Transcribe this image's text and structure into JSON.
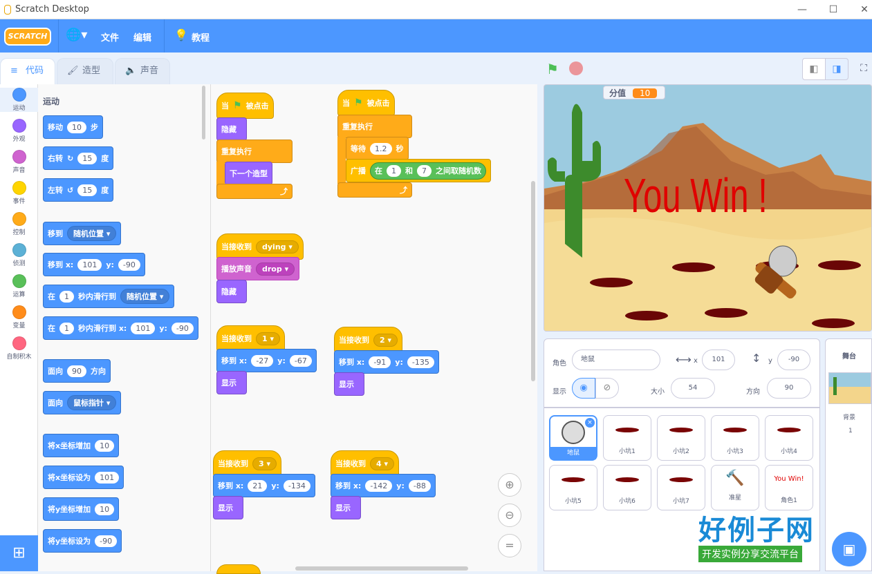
{
  "window": {
    "title": "Scratch Desktop"
  },
  "menu": {
    "logo": "SCRATCH",
    "file": "文件",
    "edit": "编辑",
    "tutorials": "教程"
  },
  "tabs": {
    "code": "代码",
    "costumes": "造型",
    "sounds": "声音"
  },
  "categories": [
    {
      "label": "运动",
      "color": "#4c97ff"
    },
    {
      "label": "外观",
      "color": "#9966ff"
    },
    {
      "label": "声音",
      "color": "#cf63cf"
    },
    {
      "label": "事件",
      "color": "#ffd500"
    },
    {
      "label": "控制",
      "color": "#ffab19"
    },
    {
      "label": "侦测",
      "color": "#5cb1d6"
    },
    {
      "label": "运算",
      "color": "#59c059"
    },
    {
      "label": "变量",
      "color": "#ff8c1a"
    },
    {
      "label": "自制积木",
      "color": "#ff6680"
    }
  ],
  "palette": {
    "section": "运动",
    "move": {
      "a": "移动",
      "n": "10",
      "b": "步"
    },
    "turn_right": {
      "a": "右转",
      "icon": "↻",
      "n": "15",
      "b": "度"
    },
    "turn_left": {
      "a": "左转",
      "icon": "↺",
      "n": "15",
      "b": "度"
    },
    "goto": {
      "a": "移到",
      "dd": "随机位置"
    },
    "goto_xy": {
      "a": "移到 x:",
      "x": "101",
      "b": "y:",
      "y": "-90"
    },
    "glide": {
      "a": "在",
      "n": "1",
      "b": "秒内滑行到",
      "dd": "随机位置"
    },
    "glide_xy": {
      "a": "在",
      "n": "1",
      "b": "秒内滑行到 x:",
      "x": "101",
      "c": "y:",
      "y": "-90"
    },
    "point": {
      "a": "面向",
      "n": "90",
      "b": "方向"
    },
    "point_towards": {
      "a": "面向",
      "dd": "鼠标指针"
    },
    "change_x": {
      "a": "将x坐标增加",
      "n": "10"
    },
    "set_x": {
      "a": "将x坐标设为",
      "n": "101"
    },
    "change_y": {
      "a": "将y坐标增加",
      "n": "10"
    },
    "set_y": {
      "a": "将y坐标设为",
      "n": "-90"
    }
  },
  "scripts": {
    "s1": {
      "hat_a": "当",
      "hat_b": "被点击",
      "hide": "隐藏",
      "forever": "重复执行",
      "next": "下一个造型"
    },
    "s2": {
      "hat_a": "当",
      "hat_b": "被点击",
      "forever": "重复执行",
      "wait_a": "等待",
      "wait_n": "1.2",
      "wait_b": "秒",
      "bc": "广播",
      "rand_a": "在",
      "rand_n1": "1",
      "rand_b": "和",
      "rand_n2": "7",
      "rand_c": "之间取随机数"
    },
    "s3": {
      "hat": "当接收到",
      "msg": "dying",
      "play": "播放声音",
      "snd": "drop",
      "hide": "隐藏"
    },
    "s4": {
      "hat": "当接收到",
      "msg": "1",
      "goto": "移到 x:",
      "x": "-27",
      "yl": "y:",
      "y": "-67",
      "show": "显示"
    },
    "s5": {
      "hat": "当接收到",
      "msg": "2",
      "goto": "移到 x:",
      "x": "-91",
      "yl": "y:",
      "y": "-135",
      "show": "显示"
    },
    "s6": {
      "hat": "当接收到",
      "msg": "3",
      "goto": "移到 x:",
      "x": "21",
      "yl": "y:",
      "y": "-134",
      "show": "显示"
    },
    "s7": {
      "hat": "当接收到",
      "msg": "4",
      "goto": "移到 x:",
      "x": "-142",
      "yl": "y:",
      "y": "-88",
      "show": "显示"
    }
  },
  "stage": {
    "monitor_label": "分值",
    "monitor_value": "10",
    "win_text": "You Win !"
  },
  "sprite_info": {
    "sprite_label": "角色",
    "sprite_name": "地鼠",
    "x_label": "x",
    "x": "101",
    "y_label": "y",
    "y": "-90",
    "show_label": "显示",
    "size_label": "大小",
    "size": "54",
    "dir_label": "方向",
    "dir": "90"
  },
  "sprites": [
    {
      "name": "地鼠",
      "kind": "mouse"
    },
    {
      "name": "小坑1",
      "kind": "hole"
    },
    {
      "name": "小坑2",
      "kind": "hole"
    },
    {
      "name": "小坑3",
      "kind": "hole"
    },
    {
      "name": "小坑4",
      "kind": "hole"
    },
    {
      "name": "小坑5",
      "kind": "hole"
    },
    {
      "name": "小坑6",
      "kind": "hole"
    },
    {
      "name": "小坑7",
      "kind": "hole"
    },
    {
      "name": "准星",
      "kind": "hammer"
    },
    {
      "name": "角色1",
      "kind": "text",
      "thumb": "You Win!"
    }
  ],
  "stage_pane": {
    "title": "舞台",
    "backdrop_label": "背景",
    "backdrop_count": "1"
  },
  "watermark": {
    "big": "好例子网",
    "small": "开发实例分享交流平台"
  }
}
